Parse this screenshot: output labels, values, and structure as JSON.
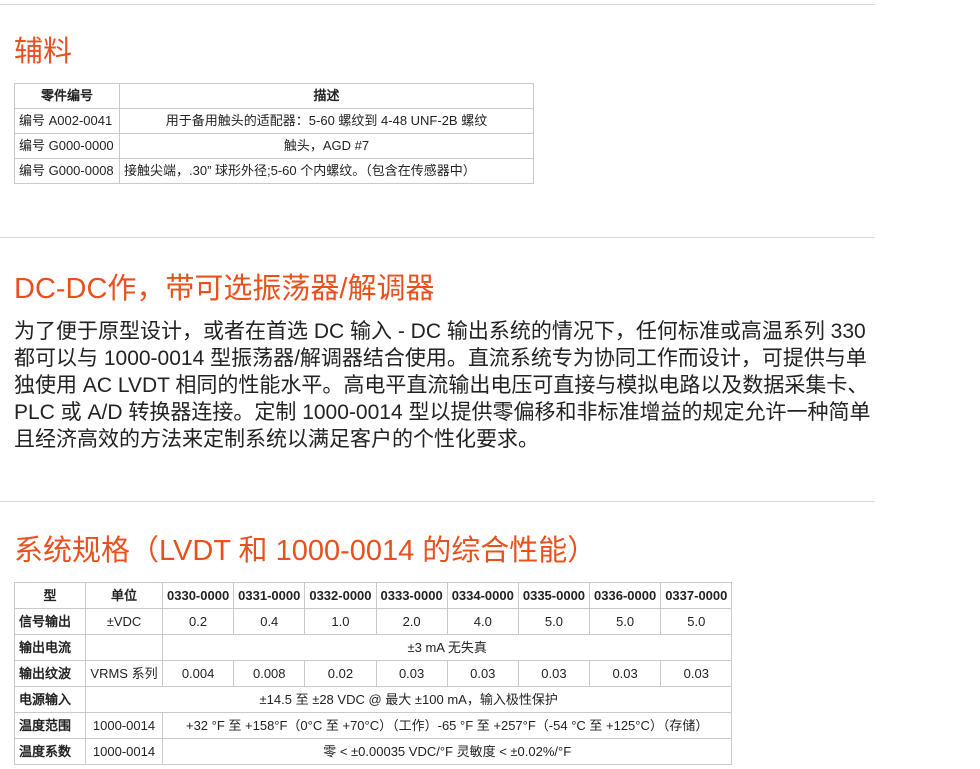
{
  "section1": {
    "title": "辅料",
    "headers": [
      "零件编号",
      "描述"
    ],
    "rows": [
      {
        "part": "编号 A002-0041",
        "desc": "用于备用触头的适配器：5-60 螺纹到 4-48 UNF-2B 螺纹"
      },
      {
        "part": "编号 G000-0000",
        "desc": "触头，AGD #7"
      },
      {
        "part": "编号 G000-0008",
        "desc": "接触尖端，.30” 球形外径;5-60 个内螺纹。（包含在传感器中）"
      }
    ]
  },
  "section2": {
    "title": "DC-DC作，带可选振荡器/解调器",
    "paragraph": "为了便于原型设计，或者在首选 DC 输入 - DC 输出系统的情况下，任何标准或高温系列 330 都可以与 1000-0014 型振荡器/解调器结合使用。直流系统专为协同工作而设计，可提供与单独使用 AC LVDT 相同的性能水平。高电平直流输出电压可直接与模拟电路以及数据采集卡、PLC 或 A/D 转换器连接。定制 1000-0014 型以提供零偏移和非标准增益的规定允许一种简单且经济高效的方法来定制系统以满足客户的个性化要求。"
  },
  "section3": {
    "title": "系统规格（LVDT 和 1000-0014 的综合性能）",
    "headers": [
      "型",
      "单位",
      "0330-0000",
      "0331-0000",
      "0332-0000",
      "0333-0000",
      "0334-0000",
      "0335-0000",
      "0336-0000",
      "0337-0000"
    ],
    "signal_output": {
      "label": "信号输出",
      "unit": "±VDC",
      "values": [
        "0.2",
        "0.4",
        "1.0",
        "2.0",
        "4.0",
        "5.0",
        "5.0",
        "5.0"
      ]
    },
    "output_current": {
      "label": "输出电流",
      "value": "±3 mA 无失真"
    },
    "output_ripple": {
      "label": "输出纹波",
      "unit": "VRMS 系列",
      "values": [
        "0.004",
        "0.008",
        "0.02",
        "0.03",
        "0.03",
        "0.03",
        "0.03",
        "0.03"
      ]
    },
    "power_input": {
      "label": "电源输入",
      "value": "±14.5 至 ±28 VDC @ 最大 ±100 mA，输入极性保护"
    },
    "temp_range": {
      "label": "温度范围",
      "unit": "1000-0014",
      "value": "+32 °F 至 +158°F（0°C 至 +70°C）（工作）-65 °F 至 +257°F（-54 °C 至 +125°C）（存储）"
    },
    "temp_coeff": {
      "label": "温度系数",
      "unit": "1000-0014",
      "value": "零 < ±0.00035 VDC/°F 灵敏度 < ±0.02%/°F"
    }
  }
}
